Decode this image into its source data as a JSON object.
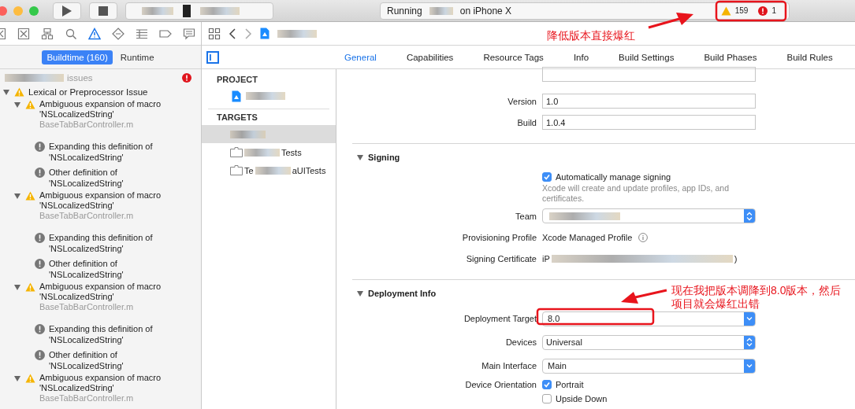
{
  "window": {
    "title_start": "Running",
    "title_end": "on iPhone X",
    "warning_count": "159",
    "error_count": "1"
  },
  "navigator": {
    "filter_tabs": [
      {
        "label": "Buildtime (160)",
        "selected": true
      },
      {
        "label": "Runtime",
        "selected": false
      }
    ],
    "summary": "issues",
    "issues": [
      {
        "kind": "warning",
        "text": "Lexical or Preprocessor Issue",
        "expanded": true,
        "children": [
          {
            "kind": "warning",
            "text": "Ambiguous expansion of macro 'NSLocalizedString'",
            "file": "BaseTabBarController.m",
            "expanded": true,
            "children": [
              {
                "kind": "note",
                "text": "Expanding this definition of 'NSLocalizedString'"
              },
              {
                "kind": "note",
                "text": "Other definition of 'NSLocalizedString'"
              }
            ]
          },
          {
            "kind": "warning",
            "text": "Ambiguous expansion of macro 'NSLocalizedString'",
            "file": "BaseTabBarController.m",
            "expanded": true,
            "children": [
              {
                "kind": "note",
                "text": "Expanding this definition of 'NSLocalizedString'"
              },
              {
                "kind": "note",
                "text": "Other definition of 'NSLocalizedString'"
              }
            ]
          },
          {
            "kind": "warning",
            "text": "Ambiguous expansion of macro 'NSLocalizedString'",
            "file": "BaseTabBarController.m",
            "expanded": true,
            "children": [
              {
                "kind": "note",
                "text": "Expanding this definition of 'NSLocalizedString'"
              },
              {
                "kind": "note",
                "text": "Other definition of 'NSLocalizedString'"
              }
            ]
          },
          {
            "kind": "warning",
            "text": "Ambiguous expansion of macro 'NSLocalizedString'",
            "file": "BaseTabBarController.m",
            "expanded": true
          }
        ]
      }
    ]
  },
  "editor_tabs": [
    {
      "label": "General",
      "selected": true
    },
    {
      "label": "Capabilities",
      "selected": false
    },
    {
      "label": "Resource Tags",
      "selected": false
    },
    {
      "label": "Info",
      "selected": false
    },
    {
      "label": "Build Settings",
      "selected": false
    },
    {
      "label": "Build Phases",
      "selected": false
    },
    {
      "label": "Build Rules",
      "selected": false
    }
  ],
  "project_panel": {
    "project_heading": "PROJECT",
    "targets_heading": "TARGETS",
    "targets": [
      {
        "selected": true
      },
      {
        "selected": false,
        "text_end": "Tests"
      },
      {
        "selected": false,
        "text_start": "Te",
        "text_end": "aUITests"
      }
    ]
  },
  "identity": [
    {
      "label": "Version",
      "value": "1.0"
    },
    {
      "label": "Build",
      "value": "1.0.4"
    }
  ],
  "signing": {
    "title": "Signing",
    "auto_label": "Automatically manage signing",
    "auto_checked": true,
    "auto_hint": "Xcode will create and update profiles, app IDs, and certificates.",
    "team_label": "Team",
    "profile_label": "Provisioning Profile",
    "profile_value": "Xcode Managed Profile",
    "certificate_label": "Signing Certificate",
    "certificate_start": "iP",
    "certificate_end": ")"
  },
  "deployment": {
    "title": "Deployment Info",
    "rows": [
      {
        "kind": "combo",
        "label": "Deployment Target",
        "value": "8.0"
      },
      {
        "kind": "popup",
        "label": "Devices",
        "value": "Universal"
      },
      {
        "kind": "combo",
        "label": "Main Interface",
        "value": "Main"
      }
    ],
    "orientation_label": "Device Orientation",
    "orientations": [
      {
        "label": "Portrait",
        "checked": true
      },
      {
        "label": "Upside Down",
        "checked": false
      }
    ]
  },
  "annotations": [
    {
      "text": "降低版本直接爆红"
    },
    {
      "text": "现在我把版本调降到8.0版本，然后项目就会爆红出错"
    }
  ]
}
